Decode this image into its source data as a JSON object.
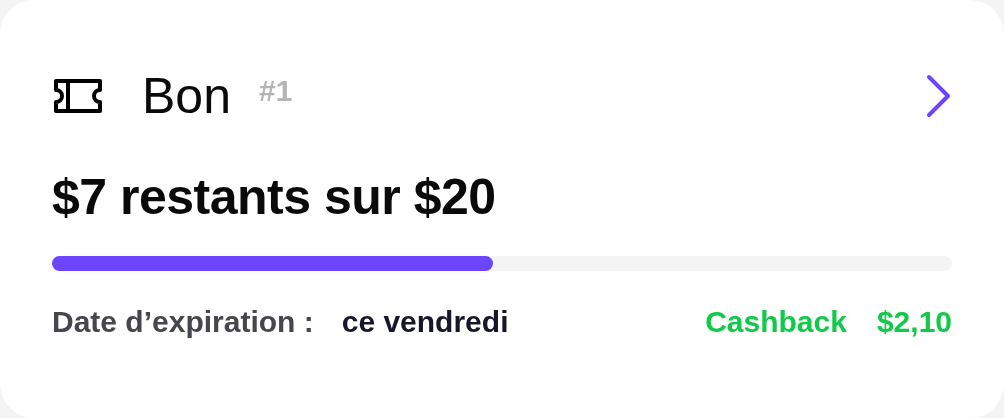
{
  "voucher": {
    "title": "Bon",
    "number": "#1",
    "amount": "$7 restants sur $20",
    "progress": {
      "level": 0.49
    },
    "expiry_label": "Date d’expiration :",
    "expiry_value": "ce vendredi",
    "cashback_label": "Cashback",
    "cashback_value": "$2,10"
  }
}
